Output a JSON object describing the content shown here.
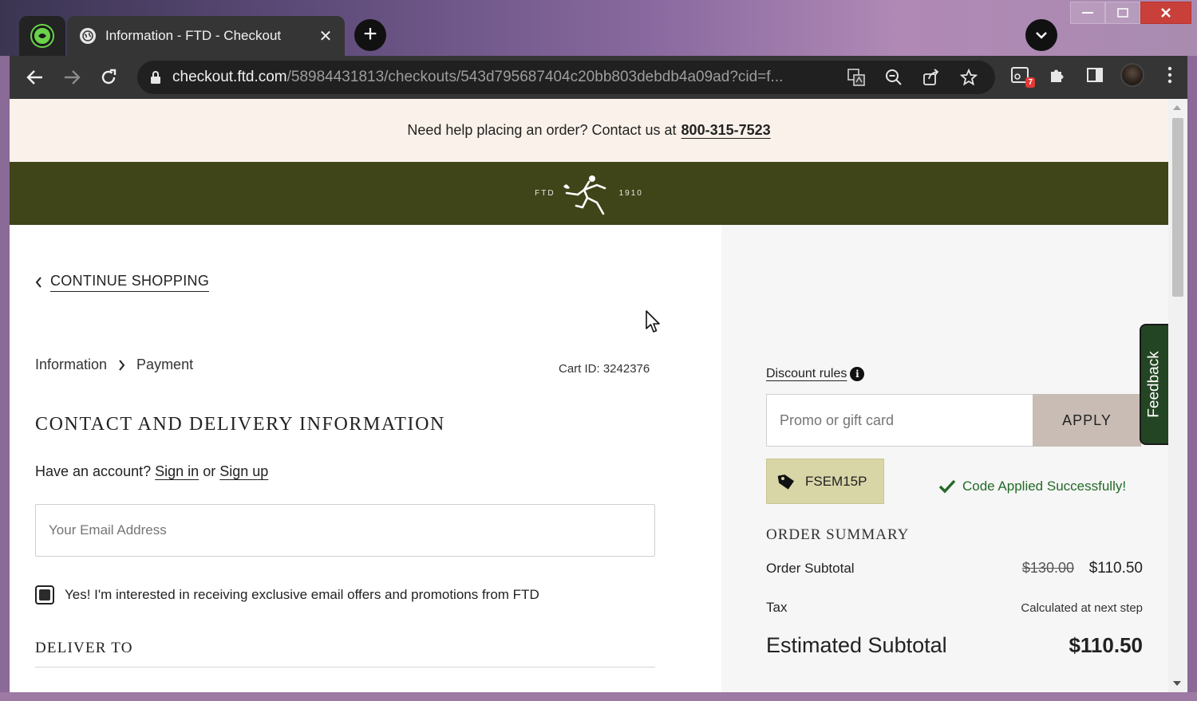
{
  "browser": {
    "tab_title": "Information - FTD - Checkout",
    "tab_close": "✕",
    "new_tab": "+",
    "url_host": "checkout.ftd.com",
    "url_path": "/58984431813/checkouts/543d795687404c20bb803debdb4a09ad?cid=f...",
    "extension_badge": "7"
  },
  "help_bar": {
    "text": "Need help placing an order? Contact us at",
    "phone": "800-315-7523"
  },
  "brand": {
    "left": "FTD",
    "right": "1910"
  },
  "nav": {
    "continue_shopping": "CONTINUE SHOPPING"
  },
  "breadcrumb": {
    "step1": "Information",
    "step2": "Payment"
  },
  "cart": {
    "id_label": "Cart ID: 3242376"
  },
  "contact": {
    "title": "CONTACT AND DELIVERY INFORMATION",
    "have_account": "Have an account?",
    "sign_in": "Sign in",
    "or": "or",
    "sign_up": "Sign up",
    "email_placeholder": "Your Email Address",
    "opt_in_label": "Yes! I'm interested in receiving exclusive email offers and promotions from FTD",
    "opt_in_checked": true
  },
  "deliver": {
    "title": "DELIVER TO"
  },
  "discount": {
    "rules_label": "Discount rules",
    "info_icon": "i",
    "promo_placeholder": "Promo or gift card",
    "apply_label": "APPLY",
    "applied_code": "FSEM15P",
    "success_message": "Code Applied Successfully!"
  },
  "order_summary": {
    "title": "ORDER SUMMARY",
    "subtotal_label": "Order Subtotal",
    "subtotal_original": "$130.00",
    "subtotal_discounted": "$110.50",
    "tax_label": "Tax",
    "tax_value": "Calculated at next step",
    "estimated_label": "Estimated Subtotal",
    "estimated_value": "$110.50"
  },
  "feedback": {
    "label": "Feedback"
  },
  "colors": {
    "brand_green": "#3f4419",
    "help_bar_bg": "#faf2ea",
    "apply_button": "#c8bcb4",
    "code_chip": "#d8d5a7",
    "success_green": "#236a28",
    "feedback_tab": "#244523"
  }
}
